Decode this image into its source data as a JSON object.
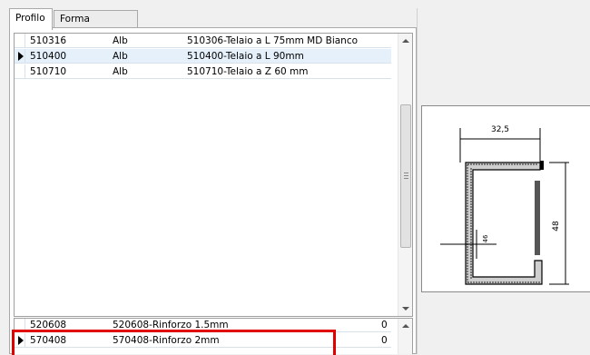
{
  "tabs": [
    {
      "label": "Profilo",
      "active": true
    },
    {
      "label": "Forma irregolare",
      "active": false
    }
  ],
  "profiles": {
    "rows": [
      {
        "code": "510316",
        "color": "Alb",
        "description": "510306-Telaio a L 75mm MD Bianco",
        "selected": false
      },
      {
        "code": "510400",
        "color": "Alb",
        "description": "510400-Telaio a L 90mm",
        "selected": true
      },
      {
        "code": "510710",
        "color": "Alb",
        "description": "510710-Telaio a Z 60 mm",
        "selected": false
      }
    ]
  },
  "reinforcements": {
    "rows": [
      {
        "code": "520608",
        "description": "520608-Rinforzo 1.5mm",
        "qty": "0",
        "selected": false
      },
      {
        "code": "570408",
        "description": "570408-Rinforzo 2mm",
        "qty": "0",
        "selected": true
      }
    ]
  },
  "drawing": {
    "dim_top": "32,5",
    "dim_right": "48",
    "dim_inner": "46"
  },
  "colors": {
    "highlight": "#e00000",
    "selected_row": "#e5f0fb"
  }
}
